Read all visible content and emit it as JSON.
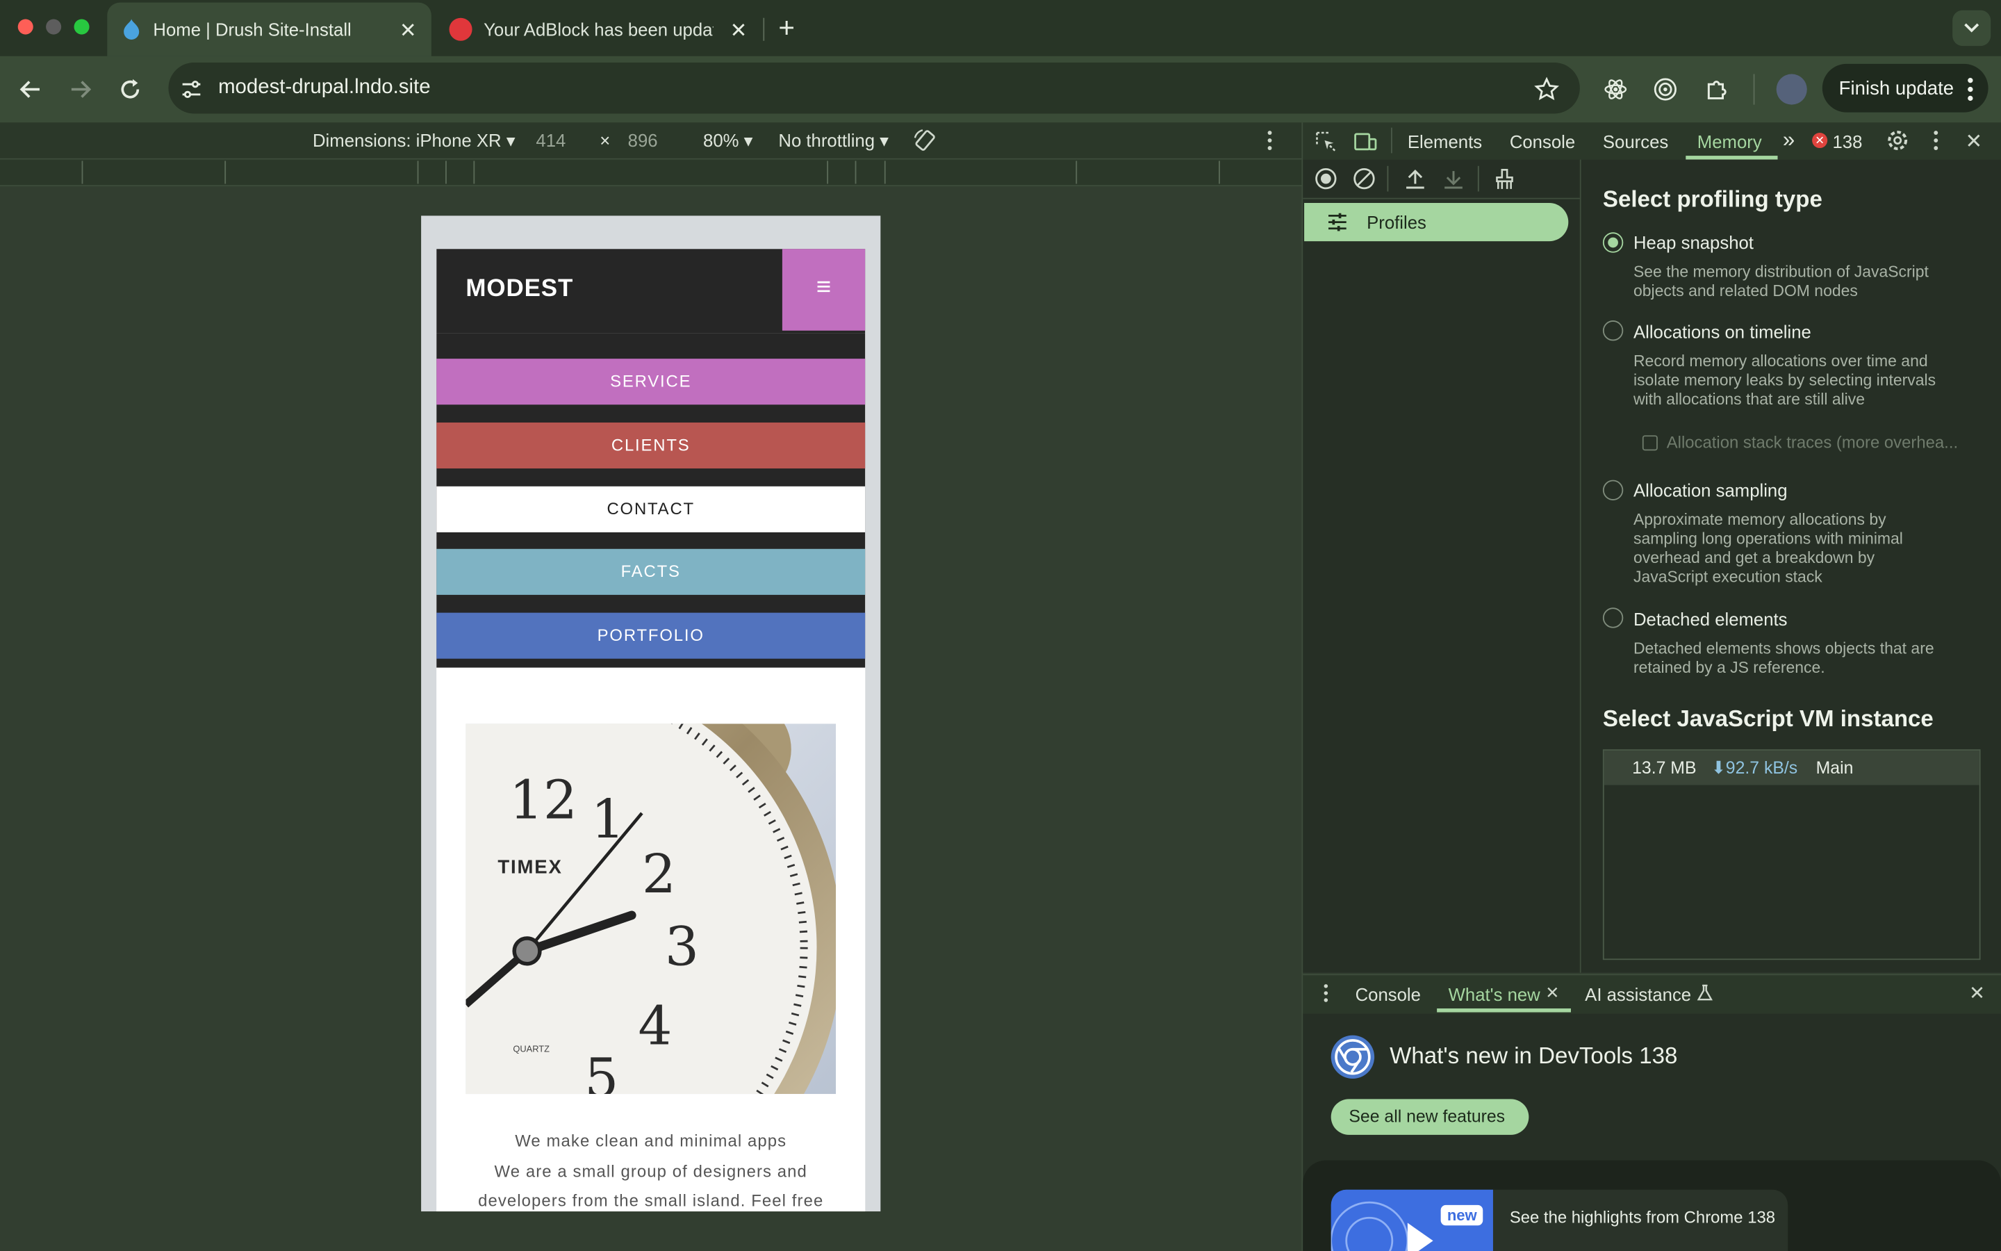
{
  "browser": {
    "tabs": [
      {
        "title": "Home | Drush Site-Install",
        "active": true,
        "icon": "drupal-icon"
      },
      {
        "title": "Your AdBlock has been updated",
        "active": false,
        "icon": "adblock-icon"
      }
    ],
    "new_tab": "+",
    "url": "modest-drupal.lndo.site",
    "finish_update": "Finish update"
  },
  "device_toolbar": {
    "dimensions": "Dimensions: iPhone XR",
    "width": "414",
    "times": "×",
    "height": "896",
    "zoom": "80%",
    "throttling": "No throttling"
  },
  "site": {
    "logo": "MODEST",
    "menu_glyph": "≡",
    "nav": [
      {
        "label": "SERVICE",
        "bg": "#c16fbf",
        "fg": "#ffffff"
      },
      {
        "label": "CLIENTS",
        "bg": "#b85651",
        "fg": "#ffffff"
      },
      {
        "label": "CONTACT",
        "bg": "#ffffff",
        "fg": "#222222"
      },
      {
        "label": "FACTS",
        "bg": "#7fb3c4",
        "fg": "#ffffff"
      },
      {
        "label": "PORTFOLIO",
        "bg": "#5273be",
        "fg": "#ffffff"
      }
    ],
    "clock_brand": "TIMEX",
    "clock_sub": "QUARTZ",
    "clock_numerals": [
      "12",
      "1",
      "2",
      "3",
      "4",
      "5"
    ],
    "text_lines": [
      "We make clean and minimal apps",
      "We are a small group of designers and",
      "developers from the small island. Feel free"
    ]
  },
  "devtools": {
    "tabs": [
      "Elements",
      "Console",
      "Sources",
      "Memory"
    ],
    "active_tab": "Memory",
    "more": "»",
    "error_count": "138",
    "sidebar_item": "Profiles",
    "select_type_title": "Select profiling type",
    "options": [
      {
        "title": "Heap snapshot",
        "desc": [
          "See the memory distribution of JavaScript",
          "objects and related DOM nodes"
        ],
        "selected": true
      },
      {
        "title": "Allocations on timeline",
        "desc": [
          "Record memory allocations over time and",
          "isolate memory leaks by selecting intervals",
          "with allocations that are still alive"
        ],
        "selected": false
      },
      {
        "title": "Allocation sampling",
        "desc": [
          "Approximate memory allocations by",
          "sampling long operations with minimal",
          "overhead and get a breakdown by",
          "JavaScript execution stack"
        ],
        "selected": false
      },
      {
        "title": "Detached elements",
        "desc": [
          "Detached elements shows objects that are",
          "retained by a JS reference."
        ],
        "selected": false
      }
    ],
    "stack_traces_label": "Allocation stack traces (more overhea...",
    "vm_title": "Select JavaScript VM instance",
    "vm": {
      "size": "13.7 MB",
      "rate": "⬇92.7 kB/s",
      "name": "Main"
    },
    "drawer": {
      "tabs": [
        "Console",
        "What's new",
        "AI assistance"
      ],
      "active": "What's new",
      "title": "What's new in DevTools 138",
      "button": "See all new features",
      "badge": "new",
      "highlight": "See the highlights from Chrome 138"
    }
  },
  "colors": {
    "accent": "#a5d6a0",
    "active_tab": "#3a4c37"
  }
}
